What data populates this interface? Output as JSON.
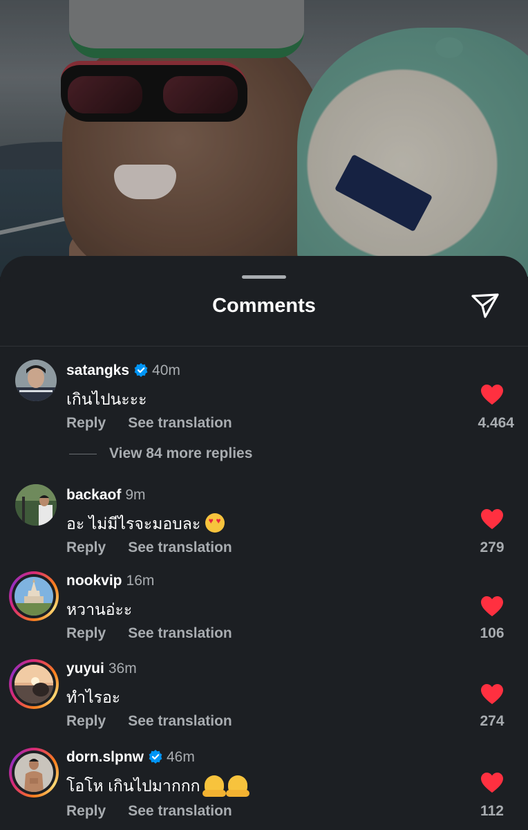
{
  "sheet": {
    "title": "Comments",
    "share_icon": "paper-plane-icon"
  },
  "colors": {
    "background": "#1c1f23",
    "like_red": "#ff3040",
    "verified_blue": "#0095f6",
    "muted_text": "#a8acb0"
  },
  "comments": [
    {
      "username": "satangks",
      "verified": true,
      "time": "40m",
      "text": "เกินไปนะะะ",
      "emoji": [],
      "reply_label": "Reply",
      "translate_label": "See translation",
      "likes": "4.464",
      "view_replies": "View 84 more replies",
      "story_ring": false
    },
    {
      "username": "backaof",
      "verified": false,
      "time": "9m",
      "text": "อะ ไม่มีไรจะมอบละ",
      "emoji": [
        "smiling-face-with-heart-eyes"
      ],
      "reply_label": "Reply",
      "translate_label": "See translation",
      "likes": "279",
      "story_ring": false
    },
    {
      "username": "nookvip",
      "verified": false,
      "time": "16m",
      "text": "หวานอ่ะะ",
      "emoji": [],
      "reply_label": "Reply",
      "translate_label": "See translation",
      "likes": "106",
      "story_ring": true
    },
    {
      "username": "yuyui",
      "verified": false,
      "time": "36m",
      "text": "ทำไรอะ",
      "emoji": [],
      "reply_label": "Reply",
      "translate_label": "See translation",
      "likes": "274",
      "story_ring": true
    },
    {
      "username": "dorn.slpnw",
      "verified": true,
      "time": "46m",
      "text": "โอโห เกินไปมากกก",
      "emoji": [
        "melting-face",
        "melting-face"
      ],
      "reply_label": "Reply",
      "translate_label": "See translation",
      "likes": "112",
      "story_ring": true
    }
  ]
}
